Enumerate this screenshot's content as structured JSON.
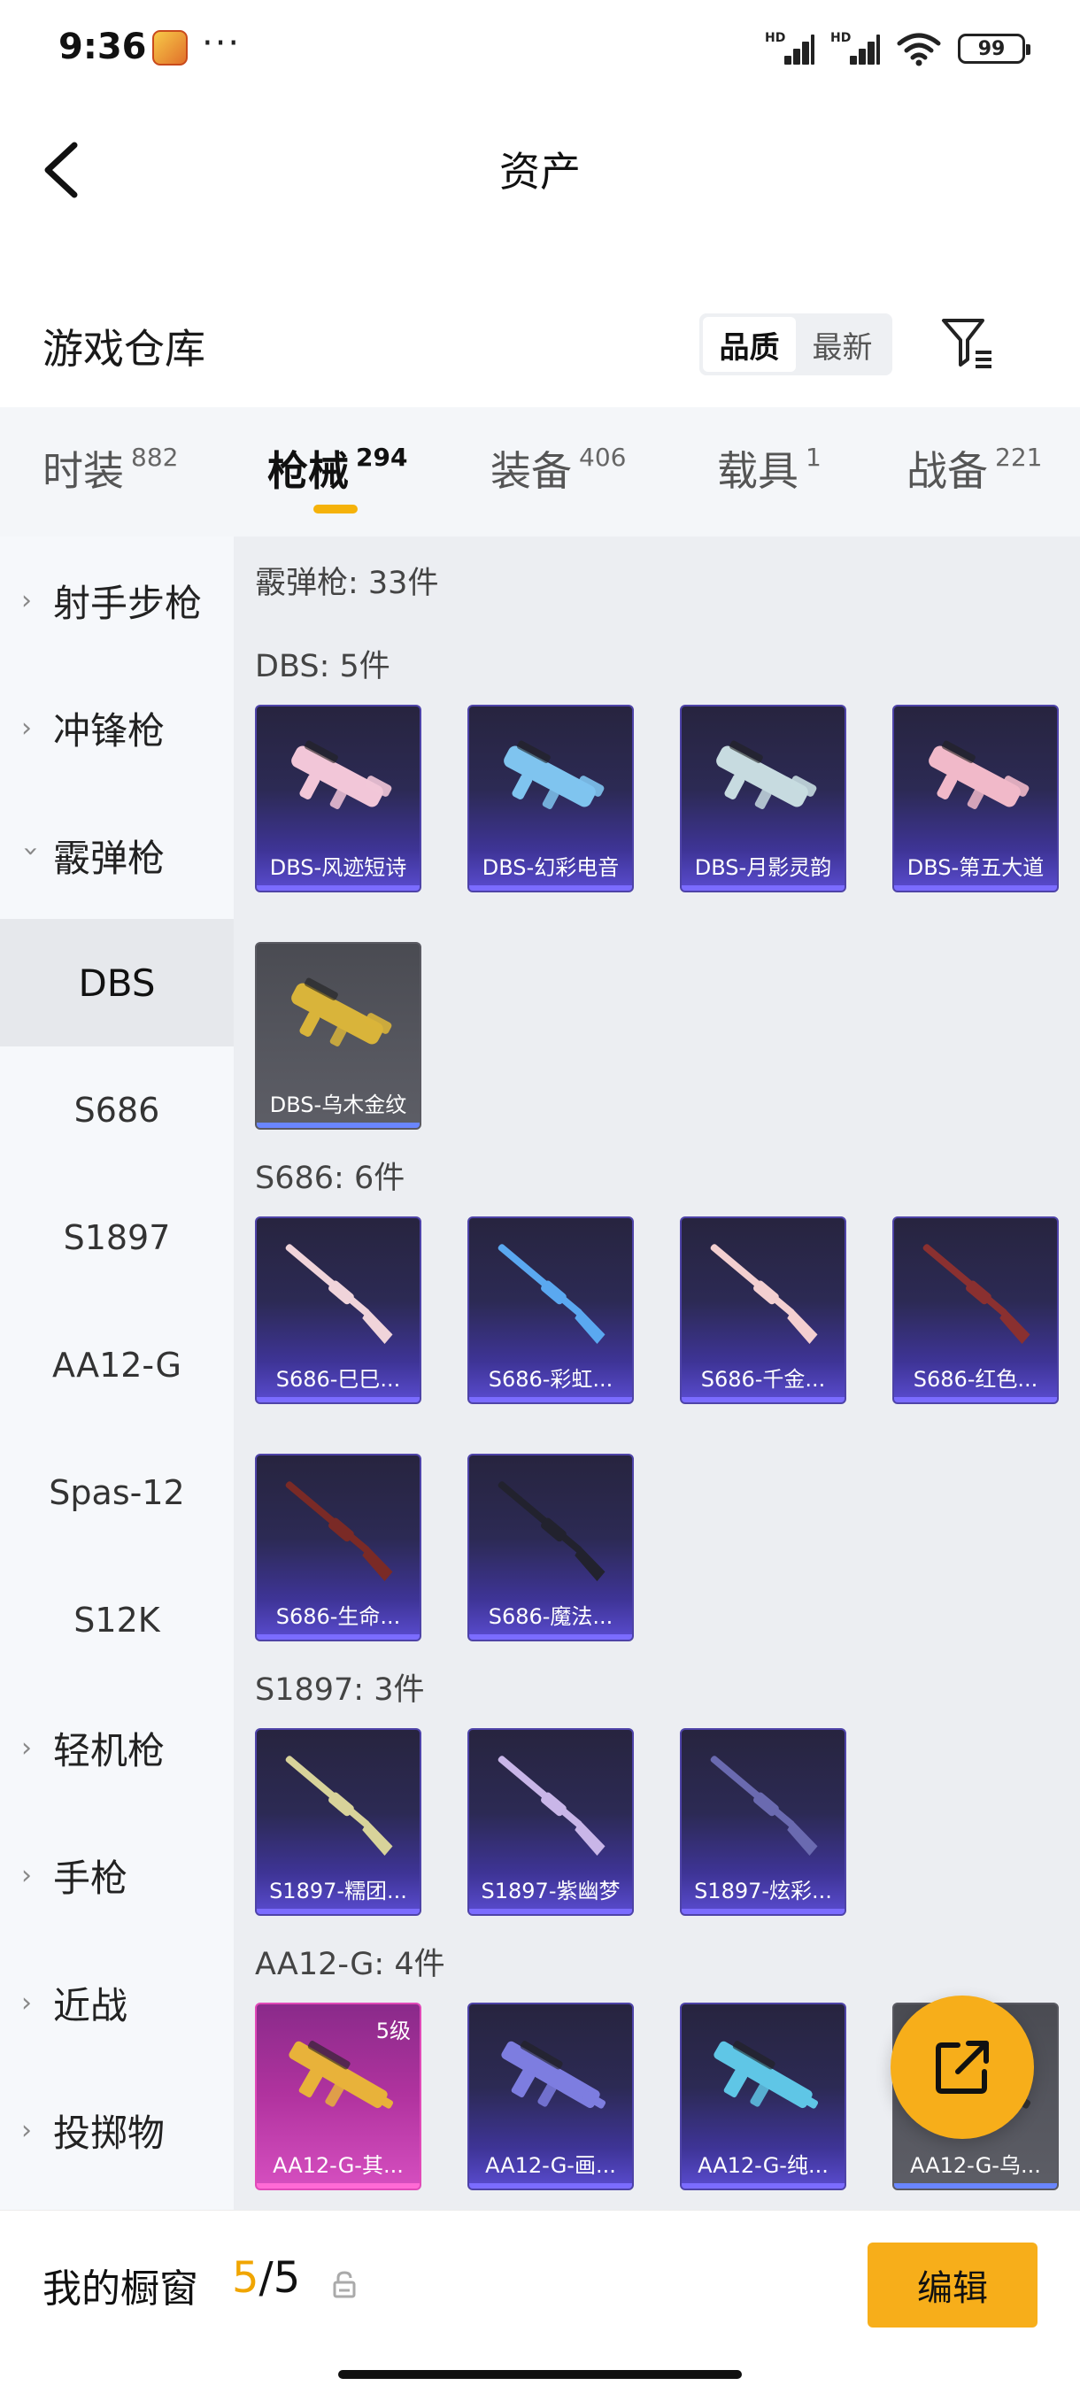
{
  "status_bar": {
    "time": "9:36",
    "dots": "···",
    "battery": "99",
    "signal_label_1": "HD",
    "signal_label_2": "HD"
  },
  "header": {
    "title": "资产"
  },
  "warehouse": {
    "title": "游戏仓库",
    "sort_options": [
      "品质",
      "最新"
    ],
    "sort_active": "品质"
  },
  "tabs": [
    {
      "label": "时装",
      "count": "882"
    },
    {
      "label": "枪械",
      "count": "294"
    },
    {
      "label": "装备",
      "count": "406"
    },
    {
      "label": "载具",
      "count": "1"
    },
    {
      "label": "战备",
      "count": "221"
    }
  ],
  "active_tab": "枪械",
  "sidebar": {
    "categories": [
      {
        "label": "射手步枪",
        "expanded": false
      },
      {
        "label": "冲锋枪",
        "expanded": false
      },
      {
        "label": "霰弹枪",
        "expanded": true
      },
      {
        "label": "轻机枪",
        "expanded": false
      },
      {
        "label": "手枪",
        "expanded": false
      },
      {
        "label": "近战",
        "expanded": false
      },
      {
        "label": "投掷物",
        "expanded": false
      }
    ],
    "subcategories": [
      "DBS",
      "S686",
      "S1897",
      "AA12-G",
      "Spas-12",
      "S12K"
    ],
    "active_sub": "DBS"
  },
  "content": {
    "summary": "霰弹枪: 33件",
    "groups": [
      {
        "title": "DBS: 5件",
        "items": [
          {
            "name": "DBS-风迹短诗",
            "style": "purple",
            "icon": "shotgun-bullpup-icon",
            "color": "#f2c6d8"
          },
          {
            "name": "DBS-幻彩电音",
            "style": "purple",
            "icon": "shotgun-bullpup-icon",
            "color": "#7fc4ef"
          },
          {
            "name": "DBS-月影灵韵",
            "style": "purple",
            "icon": "shotgun-bullpup-icon",
            "color": "#c7dbe0"
          },
          {
            "name": "DBS-第五大道",
            "style": "purple",
            "icon": "shotgun-bullpup-icon",
            "color": "#f1b9c9"
          },
          {
            "name": "DBS-乌木金纹",
            "style": "gray",
            "icon": "shotgun-bullpup-icon",
            "color": "#d9b43a"
          }
        ]
      },
      {
        "title": "S686: 6件",
        "items": [
          {
            "name": "S686-巳巳...",
            "style": "purple",
            "icon": "double-barrel-icon",
            "color": "#f0d4da"
          },
          {
            "name": "S686-彩虹...",
            "style": "purple",
            "icon": "double-barrel-icon",
            "color": "#5aa8f0"
          },
          {
            "name": "S686-千金...",
            "style": "purple",
            "icon": "double-barrel-icon",
            "color": "#f3cfd0"
          },
          {
            "name": "S686-红色...",
            "style": "purple",
            "icon": "double-barrel-icon",
            "color": "#8a3030"
          },
          {
            "name": "S686-生命...",
            "style": "purple",
            "icon": "double-barrel-icon",
            "color": "#7a2a26"
          },
          {
            "name": "S686-魔法...",
            "style": "purple",
            "icon": "double-barrel-icon",
            "color": "#22222e"
          }
        ]
      },
      {
        "title": "S1897: 3件",
        "items": [
          {
            "name": "S1897-糯团...",
            "style": "purple",
            "icon": "pump-shotgun-icon",
            "color": "#d8d39a"
          },
          {
            "name": "S1897-紫幽梦",
            "style": "purple",
            "icon": "pump-shotgun-icon",
            "color": "#c9b6e8"
          },
          {
            "name": "S1897-炫彩...",
            "style": "purple",
            "icon": "pump-shotgun-icon",
            "color": "#6a6ab0"
          }
        ]
      },
      {
        "title": "AA12-G: 4件",
        "items": [
          {
            "name": "AA12-G-其...",
            "style": "pink",
            "level": "5级",
            "icon": "auto-shotgun-icon",
            "color": "#e8b23a"
          },
          {
            "name": "AA12-G-画...",
            "style": "purple",
            "icon": "auto-shotgun-icon",
            "color": "#7d7de0"
          },
          {
            "name": "AA12-G-纯...",
            "style": "purple",
            "icon": "auto-shotgun-icon",
            "color": "#5fc6e6"
          },
          {
            "name": "AA12-G-乌...",
            "style": "gray",
            "icon": "auto-shotgun-icon",
            "color": "#333333"
          }
        ]
      }
    ]
  },
  "bottom_bar": {
    "label": "我的橱窗",
    "count_current": "5",
    "count_separator": "/",
    "count_total": "5",
    "edit_label": "编辑"
  },
  "colors": {
    "accent": "#f7ae1a",
    "purple_card": "#3e3496",
    "sidebar_bg": "#f6f8fb",
    "content_bg": "#eceef2"
  }
}
